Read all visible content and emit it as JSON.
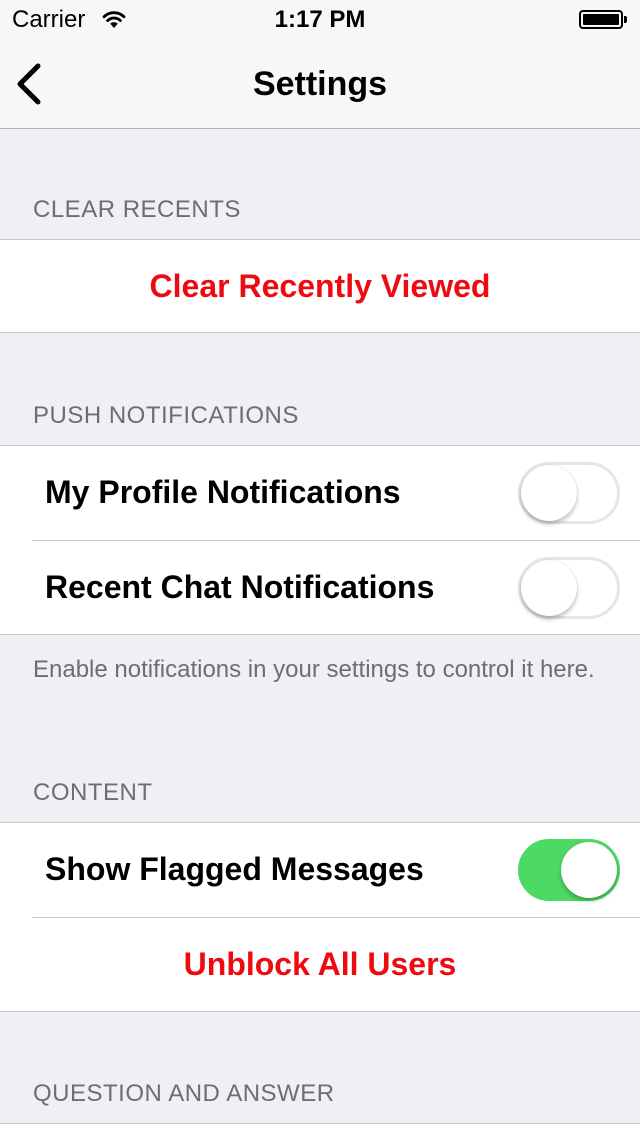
{
  "status_bar": {
    "carrier": "Carrier",
    "time": "1:17 PM",
    "wifi_icon": "wifi-icon",
    "battery_icon": "battery-icon"
  },
  "nav": {
    "title": "Settings",
    "back_icon": "chevron-left-icon"
  },
  "sections": {
    "clear_recents": {
      "header": "CLEAR RECENTS",
      "action_label": "Clear Recently Viewed"
    },
    "push_notifications": {
      "header": "PUSH NOTIFICATIONS",
      "rows": [
        {
          "label": "My Profile Notifications",
          "enabled": false
        },
        {
          "label": "Recent Chat Notifications",
          "enabled": false
        }
      ],
      "footer": "Enable notifications in your settings to control it here."
    },
    "content": {
      "header": "CONTENT",
      "show_flagged_label": "Show Flagged Messages",
      "show_flagged_enabled": true,
      "unblock_label": "Unblock All Users"
    },
    "question_and_answer": {
      "header": "QUESTION AND ANSWER"
    }
  },
  "colors": {
    "background": "#efeff4",
    "destructive": "#ee0a11",
    "switch_on": "#4cd964",
    "section_text": "#6d6d72"
  }
}
